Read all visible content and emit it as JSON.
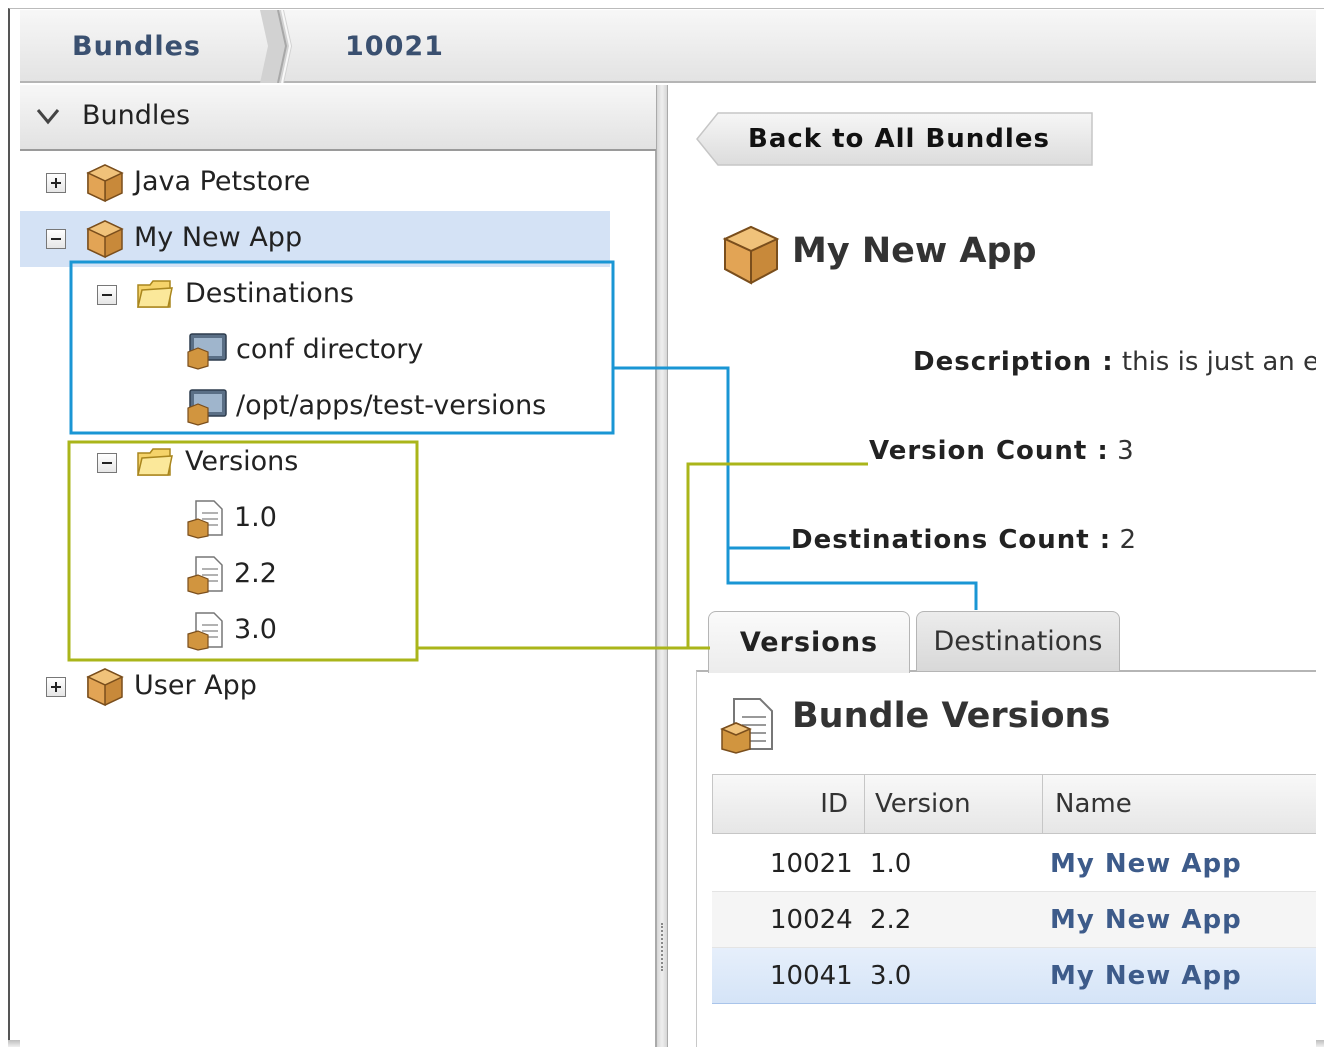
{
  "breadcrumb": {
    "items": [
      "Bundles",
      "10021"
    ]
  },
  "left_panel": {
    "header": "Bundles",
    "tree": {
      "java_petstore": "Java Petstore",
      "my_new_app": "My New App",
      "destinations": "Destinations",
      "dest_items": [
        "conf directory",
        "/opt/apps/test-versions"
      ],
      "versions": "Versions",
      "version_items": [
        "1.0",
        "2.2",
        "3.0"
      ],
      "user_app": "User App"
    }
  },
  "detail": {
    "back_button": "Back to All Bundles",
    "title": "My New App",
    "description_label": "Description :",
    "description_value": "this is just an e",
    "version_count_label": "Version Count :",
    "version_count_value": "3",
    "destinations_count_label": "Destinations Count :",
    "destinations_count_value": "2",
    "tabs": [
      "Versions",
      "Destinations"
    ],
    "section_title": "Bundle Versions",
    "table": {
      "columns": [
        "ID",
        "Version",
        "Name"
      ],
      "rows": [
        {
          "id": "10021",
          "version": "1.0",
          "name": "My New App"
        },
        {
          "id": "10024",
          "version": "2.2",
          "name": "My New App"
        },
        {
          "id": "10041",
          "version": "3.0",
          "name": "My New App"
        }
      ]
    }
  },
  "annotation_colors": {
    "destinations": "#1a96d4",
    "versions": "#aab51a"
  }
}
